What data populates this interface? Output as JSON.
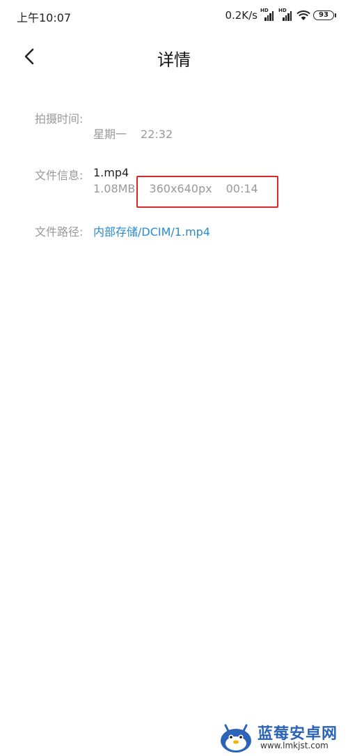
{
  "status_bar": {
    "time": "上午10:07",
    "network_speed": "0.2K/s",
    "sim1_tag": "HD",
    "sim2_tag": "HD",
    "battery": "93",
    "icons": [
      "signal-icon",
      "signal-icon",
      "wifi-icon",
      "battery-icon"
    ]
  },
  "header": {
    "title": "详情",
    "back_icon": "chevron-left-icon"
  },
  "details": {
    "capture_time": {
      "label": "拍摄时间:",
      "weekday": "星期一",
      "time": "22:32"
    },
    "file_info": {
      "label": "文件信息:",
      "name": "1.mp4",
      "size": "1.08MB",
      "resolution": "360x640px",
      "duration": "00:14"
    },
    "file_path": {
      "label": "文件路径:",
      "path": "内部存储/DCIM/1.mp4"
    }
  },
  "annotation": {
    "highlight_color": "#d9262b"
  },
  "watermark": {
    "name": "蓝莓安卓网",
    "url": "www.lmkjst.com"
  },
  "colors": {
    "link": "#2a8ad4",
    "label_grey": "#999999",
    "brand_blue": "#2a63b8"
  }
}
